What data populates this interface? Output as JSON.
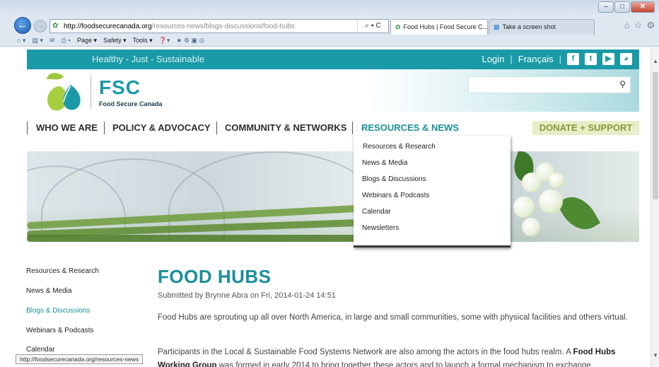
{
  "browser": {
    "url_domain": "http://foodsecurecanada.org",
    "url_path": "/resources-news/blogs-discussions/food-hubs",
    "search_hint": "⌕ ▾ C",
    "tabs": [
      {
        "label": "Food Hubs | Food Secure C...",
        "close": "×"
      },
      {
        "label": "Take a screen shot",
        "close": ""
      }
    ],
    "commands": [
      "Page ▾",
      "Safety ▾",
      "Tools ▾"
    ],
    "status_url": "http://foodsecurecanada.org/resources-news"
  },
  "site": {
    "tagline": "Healthy - Just - Sustainable",
    "login": "Login",
    "language": "Français",
    "logo_text": "FSC",
    "logo_sub": "Food Secure Canada",
    "social": [
      "f",
      "t",
      "▶",
      "◕"
    ],
    "colors": {
      "teal": "#1a9aa6",
      "donate_bg": "#e6edc7",
      "donate_text": "#8a9a35"
    }
  },
  "nav": {
    "items": [
      "WHO WE ARE",
      "POLICY & ADVOCACY",
      "COMMUNITY & NETWORKS",
      "RESOURCES & NEWS"
    ],
    "donate": "DONATE + SUPPORT"
  },
  "dropdown": {
    "items": [
      "Resources & Research",
      "News & Media",
      "Blogs & Discussions",
      "Webinars & Podcasts",
      "Calendar",
      "Newsletters"
    ]
  },
  "sidebar": {
    "items": [
      "Resources & Research",
      "News & Media",
      "Blogs & Discussions",
      "Webinars & Podcasts",
      "Calendar"
    ]
  },
  "article": {
    "title": "FOOD HUBS",
    "meta": "Submitted by Brynne Abra on Fri, 2014-01-24 14:51",
    "para1": "Food Hubs are sprouting up all over North America, in large and small communities, some with physical facilities and others virtual.",
    "para2_start": "Participants in the Local & Sustainable Food Systems Network are also among the actors in the food hubs realm. A ",
    "para2_bold": "Food Hubs Working Group",
    "para2_end": " was formed in early 2014 to bring together these actors and to launch a formal mechanism to exchange"
  }
}
